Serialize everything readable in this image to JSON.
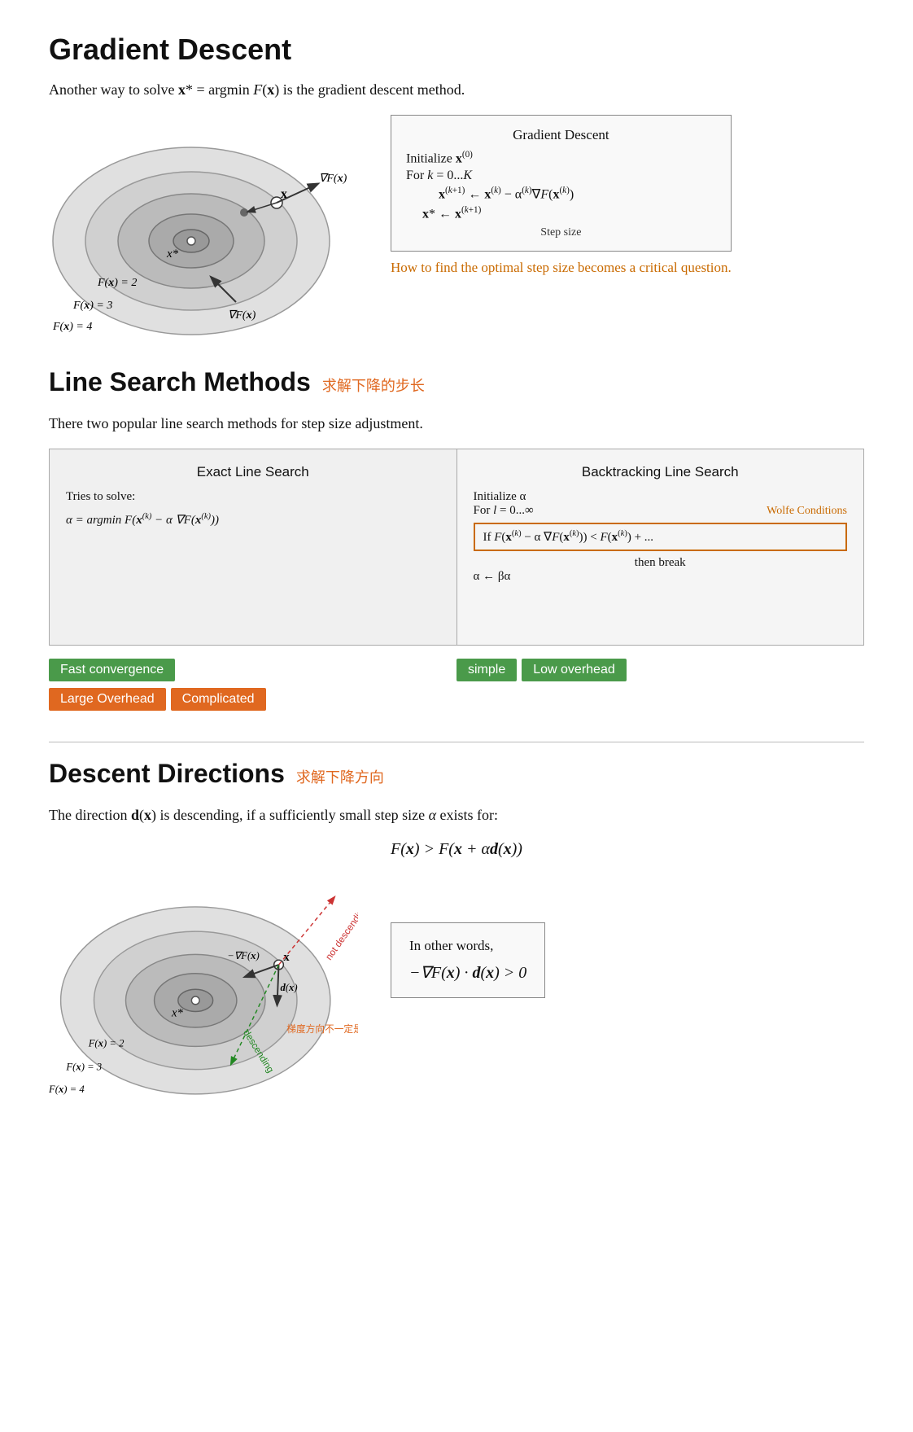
{
  "page": {
    "title": "Gradient Descent",
    "intro": "Another way to solve x* = argmin F(x) is the gradient descent method.",
    "gd_algo": {
      "title": "Gradient Descent",
      "line1": "Initialize x⁽⁰⁾",
      "line2": "For k = 0...K",
      "line3": "x⁽ᵏ⁺¹⁾ ← x⁽ᵏ⁾ − α⁽ᵏ⁾∇F(x⁽ᵏ⁾)",
      "line4": "x* ← x⁽ᵏ⁺¹⁾",
      "step_size_label": "Step size",
      "orange_note": "How to find the optimal step size becomes a critical question."
    },
    "contour_labels": [
      "F(x) = 2",
      "F(x) = 3",
      "F(x) = 4"
    ],
    "line_search": {
      "heading": "Line Search Methods",
      "chinese": "求解下降的步长",
      "intro": "There two popular line search methods for step size adjustment.",
      "exact": {
        "title": "Exact Line Search",
        "desc": "Tries to solve:",
        "formula": "α = argmin F(x⁽ᵏ⁾ − α ∇F(x⁽ᵏ⁾))",
        "tags": [
          "Fast convergence",
          "Large Overhead",
          "Complicated"
        ]
      },
      "backtracking": {
        "title": "Backtracking Line Search",
        "line1": "Initialize α",
        "line2": "For l = 0...∞",
        "wolfe_label": "Wolfe Conditions",
        "wolfe_line": "If F(x⁽ᵏ⁾ − α ∇F(x⁽ᵏ⁾)) < F(x⁽ᵏ⁾) + ...",
        "line3": "then break",
        "line4": "α ← βα",
        "tags": [
          "simple",
          "Low overhead"
        ]
      }
    },
    "descent": {
      "heading": "Descent Directions",
      "chinese": "求解下降方向",
      "intro": "The direction d(x) is descending, if a sufficiently small step size α exists for:",
      "formula": "F(x) > F(x + αd(x))",
      "inwords_title": "In other words,",
      "inwords_formula": "−∇F(x) · d(x) > 0",
      "contour_labels": [
        "F(x) = 2",
        "F(x) = 3",
        "F(x) = 4"
      ],
      "chinese_note": "梯度方向不一定是最优方向",
      "descending_label": "descending",
      "not_descending_label": "not descending"
    }
  }
}
